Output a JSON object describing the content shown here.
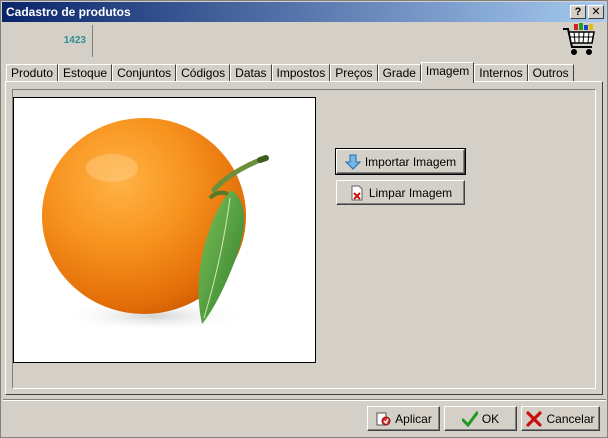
{
  "window": {
    "title": "Cadastro de produtos",
    "help_label": "?",
    "close_label": "✕"
  },
  "header": {
    "product_code": "1423",
    "cart_icon": "shopping-cart-icon"
  },
  "tabs": [
    {
      "label": "Produto",
      "active": false
    },
    {
      "label": "Estoque",
      "active": false
    },
    {
      "label": "Conjuntos",
      "active": false
    },
    {
      "label": "Códigos",
      "active": false
    },
    {
      "label": "Datas",
      "active": false
    },
    {
      "label": "Impostos",
      "active": false
    },
    {
      "label": "Preços",
      "active": false
    },
    {
      "label": "Grade",
      "active": false
    },
    {
      "label": "Imagem",
      "active": true
    },
    {
      "label": "Internos",
      "active": false
    },
    {
      "label": "Outros",
      "active": false
    }
  ],
  "image_tab": {
    "import_label": "Importar Imagem",
    "clear_label": "Limpar Imagem",
    "image_subject": "orange-fruit-with-leaf"
  },
  "footer": {
    "apply_label": "Aplicar",
    "ok_label": "OK",
    "cancel_label": "Cancelar"
  },
  "colors": {
    "titlebar_start": "#0a246a",
    "titlebar_end": "#a6caf0",
    "face": "#d4d0c8",
    "code": "#2f8f8f"
  }
}
